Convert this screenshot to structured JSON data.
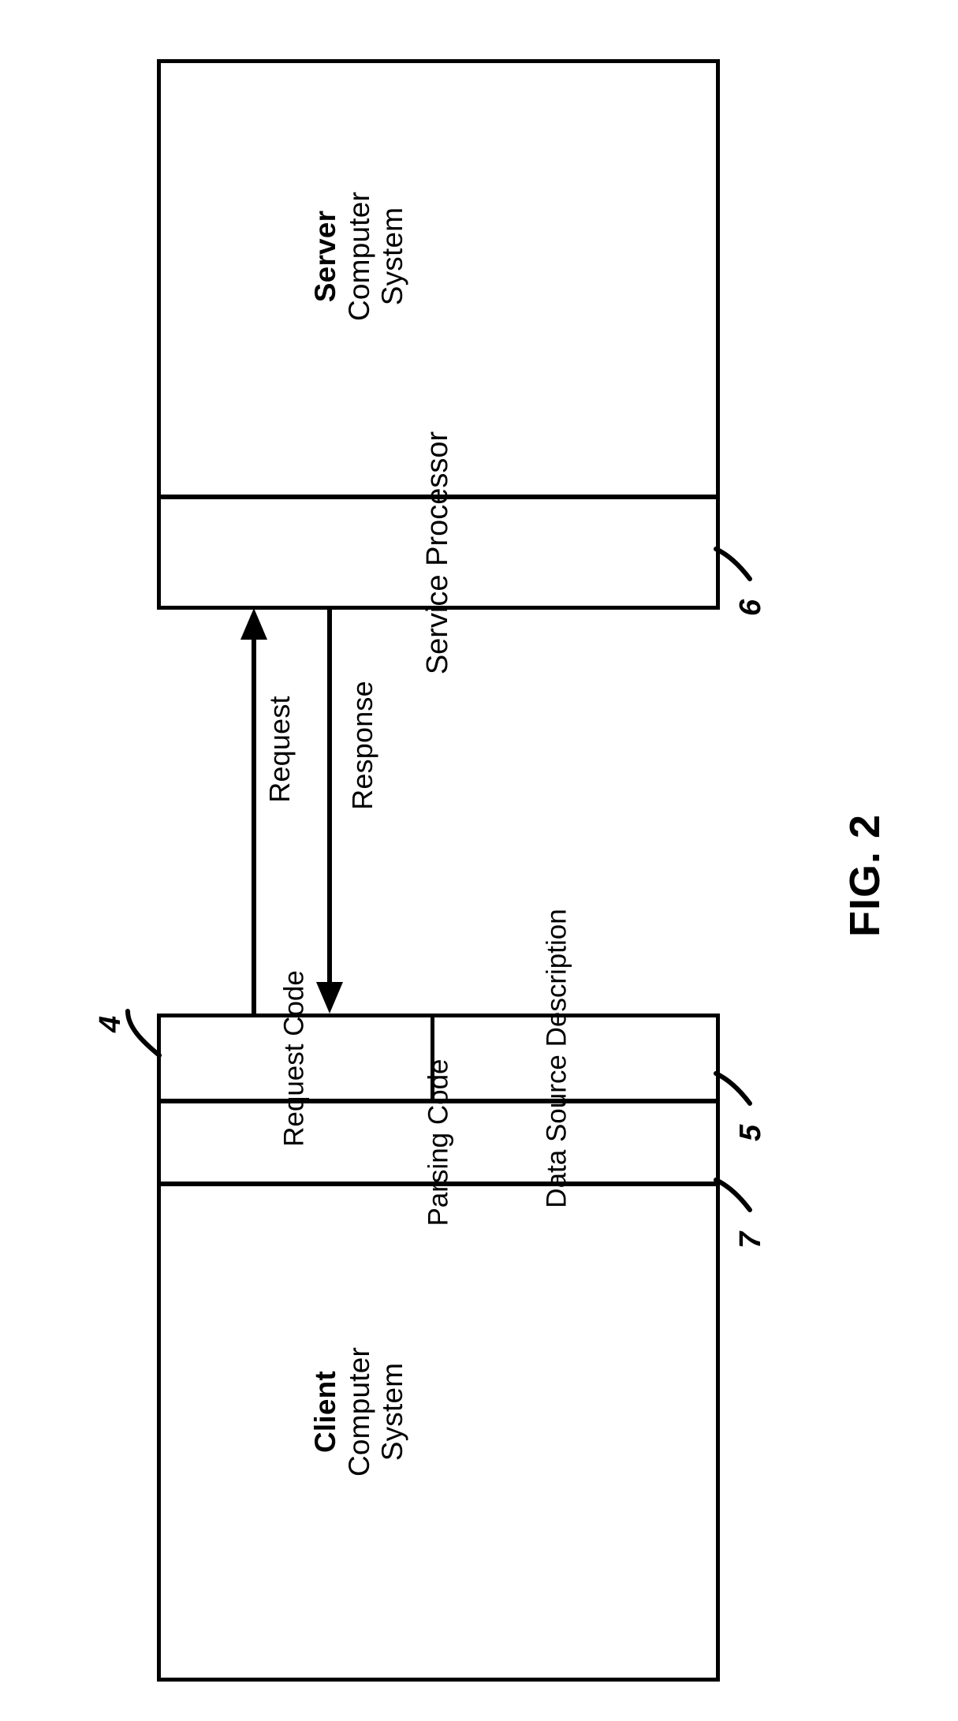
{
  "figure": {
    "caption": "FIG. 2",
    "orientation": "rotated-90-ccw"
  },
  "server": {
    "title_bold": "Server",
    "title_line2": "Computer",
    "title_line3": "System",
    "service_processor_label": "Service Processor",
    "ref_numeral": "6"
  },
  "flows": {
    "request_label": "Request",
    "response_label": "Response"
  },
  "client": {
    "request_code_label": "Request Code",
    "data_source_line1": "Data Source",
    "data_source_line2": "Description",
    "parsing_code_label": "Parsing Code",
    "title_bold": "Client",
    "title_line2": "Computer",
    "title_line3": "System",
    "ref_numeral_request_code": "4",
    "ref_numeral_data_source": "5",
    "ref_numeral_parsing_code": "7"
  },
  "colors": {
    "ink": "#000000",
    "paper": "#ffffff"
  }
}
